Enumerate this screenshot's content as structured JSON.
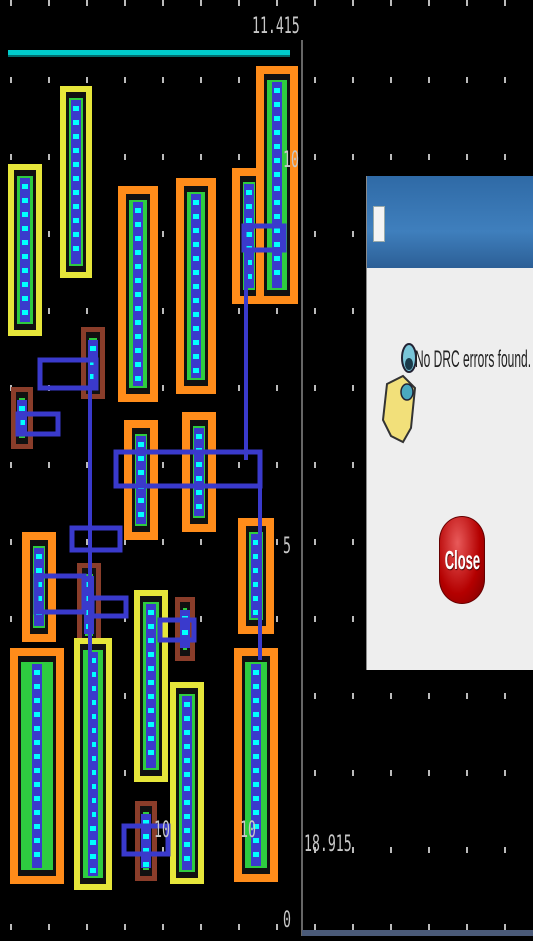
{
  "layout_viewer": {
    "ruler_labels": {
      "top": "11.415",
      "mid_upper": "10",
      "mid": "5",
      "lower": "18.915",
      "cell_a": "10",
      "cell_b": "10",
      "bottom": "0"
    }
  },
  "dialog": {
    "message": "No DRC errors found.",
    "close_label": "Close",
    "icon": "cartoon-scroll-icon"
  },
  "colors": {
    "background": "#000000",
    "poly": "#ff8c1a",
    "metal1": "#3a3acc",
    "nwell": "#e6e63a",
    "diffusion": "#2ecc40",
    "contact": "#00ffff",
    "cutline": "#00cccc"
  }
}
